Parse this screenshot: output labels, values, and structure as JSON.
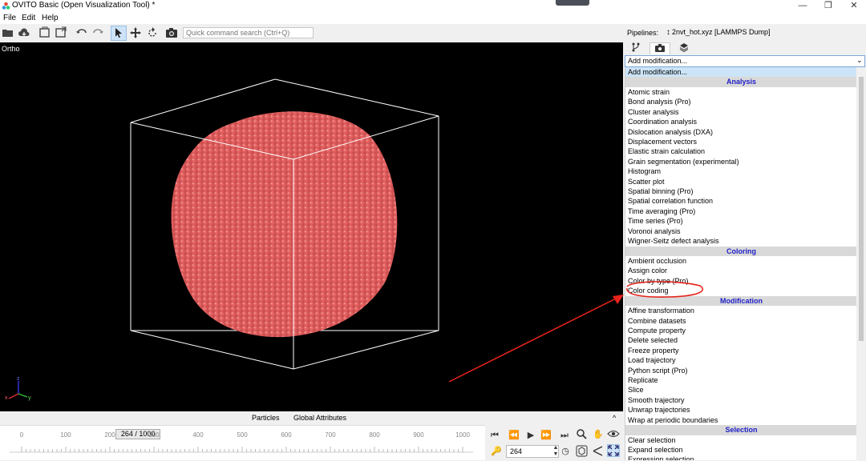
{
  "window": {
    "title": "OVITO Basic (Open Visualization Tool) *",
    "minimize": "—",
    "restore": "❐",
    "close": "✕"
  },
  "menu": [
    "File",
    "Edit",
    "Help"
  ],
  "toolbar": {
    "icons": [
      "open-folder-icon",
      "cloud-download-icon",
      "new-window-icon",
      "export-icon",
      "undo-icon",
      "redo-icon",
      "select-icon",
      "move-icon",
      "rotate-icon",
      "camera-icon"
    ],
    "quick_search_placeholder": "Quick command search (Ctrl+Q)"
  },
  "viewport": {
    "label": "Ortho",
    "axis_labels": [
      "z",
      "x",
      "y"
    ]
  },
  "bottom_tabs": [
    "Particles",
    "Global Attributes"
  ],
  "timeline": {
    "ticks": [
      "0",
      "100",
      "200",
      "300",
      "400",
      "500",
      "600",
      "700",
      "800",
      "900",
      "1000"
    ],
    "frame_box": "264 / 1000",
    "current_frame": 0.264
  },
  "animation": {
    "frame_value": "264"
  },
  "right_panel": {
    "pipelines_label": "Pipelines:",
    "pipeline_name": "2nvt_hot.xyz [LAMMPS Dump]",
    "combo_text": "Add modification...",
    "list": [
      {
        "text": "Add modification...",
        "kind": "first"
      },
      {
        "text": "Analysis",
        "kind": "hdr"
      },
      {
        "text": "Atomic strain",
        "kind": "item"
      },
      {
        "text": "Bond analysis (Pro)",
        "kind": "item"
      },
      {
        "text": "Cluster analysis",
        "kind": "item"
      },
      {
        "text": "Coordination analysis",
        "kind": "item"
      },
      {
        "text": "Dislocation analysis (DXA)",
        "kind": "item"
      },
      {
        "text": "Displacement vectors",
        "kind": "item"
      },
      {
        "text": "Elastic strain calculation",
        "kind": "item"
      },
      {
        "text": "Grain segmentation (experimental)",
        "kind": "item"
      },
      {
        "text": "Histogram",
        "kind": "item"
      },
      {
        "text": "Scatter plot",
        "kind": "item"
      },
      {
        "text": "Spatial binning (Pro)",
        "kind": "item"
      },
      {
        "text": "Spatial correlation function",
        "kind": "item"
      },
      {
        "text": "Time averaging (Pro)",
        "kind": "item"
      },
      {
        "text": "Time series (Pro)",
        "kind": "item"
      },
      {
        "text": "Voronoi analysis",
        "kind": "item"
      },
      {
        "text": "Wigner-Seitz defect analysis",
        "kind": "item"
      },
      {
        "text": "Coloring",
        "kind": "hdr"
      },
      {
        "text": "Ambient occlusion",
        "kind": "item"
      },
      {
        "text": "Assign color",
        "kind": "item"
      },
      {
        "text": "Color by type (Pro)",
        "kind": "item"
      },
      {
        "text": "Color coding",
        "kind": "item"
      },
      {
        "text": "Modification",
        "kind": "hdr"
      },
      {
        "text": "Affine transformation",
        "kind": "item"
      },
      {
        "text": "Combine datasets",
        "kind": "item"
      },
      {
        "text": "Compute property",
        "kind": "item"
      },
      {
        "text": "Delete selected",
        "kind": "item"
      },
      {
        "text": "Freeze property",
        "kind": "item"
      },
      {
        "text": "Load trajectory",
        "kind": "item"
      },
      {
        "text": "Python script (Pro)",
        "kind": "item"
      },
      {
        "text": "Replicate",
        "kind": "item"
      },
      {
        "text": "Slice",
        "kind": "item"
      },
      {
        "text": "Smooth trajectory",
        "kind": "item"
      },
      {
        "text": "Unwrap trajectories",
        "kind": "item"
      },
      {
        "text": "Wrap at periodic boundaries",
        "kind": "item"
      },
      {
        "text": "Selection",
        "kind": "hdr"
      },
      {
        "text": "Clear selection",
        "kind": "item"
      },
      {
        "text": "Expand selection",
        "kind": "item"
      },
      {
        "text": "Expression selection",
        "kind": "item"
      }
    ]
  },
  "colors": {
    "particles": "#e05a5a",
    "annotation": "#e8231a",
    "header_text": "#2020c8"
  }
}
